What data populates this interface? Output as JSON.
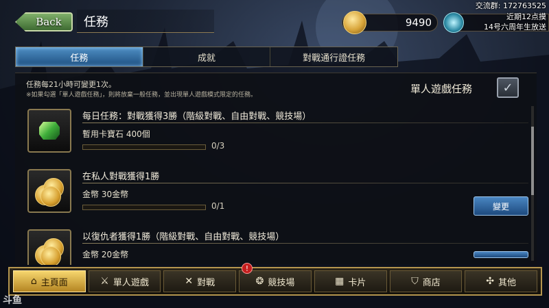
{
  "header": {
    "back_label": "Back",
    "title": "任務",
    "gold": "9490"
  },
  "overlay": {
    "line1": "交流群: 172763525",
    "line2": "近期12点摸",
    "line3": "14号六周年生放送"
  },
  "tabs": [
    {
      "label": "任務",
      "active": true
    },
    {
      "label": "成就",
      "active": false
    },
    {
      "label": "對戰通行證任務",
      "active": false
    }
  ],
  "info": {
    "line1": "任務每21小時可變更1次。",
    "line2": "※如果勾選「單人遊戲任務」，則將放棄一般任務，並出現單人遊戲模式限定的任務。",
    "solo_label": "單人遊戲任務"
  },
  "missions": [
    {
      "title": "每日任務：對戰獲得3勝（階級對戰、自由對戰、競技場）",
      "reward": "暫用卡寶石 400個",
      "progress": "0/3",
      "progress_fraction": 0,
      "icon": "gem-icon"
    },
    {
      "title": "在私人對戰獲得1勝",
      "reward": "金幣 30金幣",
      "progress": "0/1",
      "progress_fraction": 0,
      "icon": "coin-icon",
      "button": "變更"
    },
    {
      "title": "以復仇者獲得1勝（階級對戰、自由對戰、競技場）",
      "reward": "金幣 20金幣",
      "icon": "coin-icon"
    }
  ],
  "nav": [
    {
      "label": "主頁面",
      "icon": "home-icon",
      "glyph": "⌂",
      "active": true
    },
    {
      "label": "單人遊戲",
      "icon": "sword-icon",
      "glyph": "⚔",
      "active": false
    },
    {
      "label": "對戰",
      "icon": "crossed-swords-icon",
      "glyph": "✕",
      "active": false
    },
    {
      "label": "競技場",
      "icon": "arena-icon",
      "glyph": "❂",
      "active": false
    },
    {
      "label": "卡片",
      "icon": "cards-icon",
      "glyph": "▦",
      "active": false
    },
    {
      "label": "商店",
      "icon": "shop-icon",
      "glyph": "⛉",
      "active": false
    },
    {
      "label": "其他",
      "icon": "gear-icon",
      "glyph": "✣",
      "active": false
    }
  ],
  "badge": "!",
  "watermark": "斗鱼"
}
